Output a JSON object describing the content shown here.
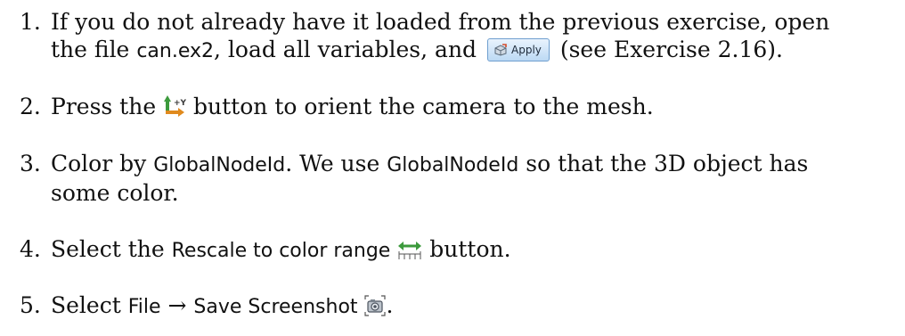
{
  "steps": [
    {
      "number": "1.",
      "text_a": "If you do not already have it loaded from the previous exercise, open",
      "text_b": "the file ",
      "file": "can.ex2",
      "text_c": ", load all variables, and",
      "apply_label": "Apply",
      "text_d": "(see Exercise 2.16)."
    },
    {
      "number": "2.",
      "text_a": "Press the",
      "text_b": "button to orient the camera to the mesh.",
      "icon": "orient-camera-plus-y-icon"
    },
    {
      "number": "3.",
      "text_a": "Color by ",
      "var1": "GlobalNodeId",
      "text_b": ". We use ",
      "var2": "GlobalNodeId",
      "text_c": " so that the 3D object has",
      "text_d": "some color."
    },
    {
      "number": "4.",
      "text_a": "Select the ",
      "action": "Rescale to color range",
      "text_b": "button.",
      "icon": "rescale-color-range-icon"
    },
    {
      "number": "5.",
      "text_a": "Select ",
      "menu": "File",
      "arrow": "→",
      "menu_item": "Save Screenshot",
      "text_b": ".",
      "icon": "camera-screenshot-icon"
    }
  ],
  "colors": {
    "text": "#111111",
    "apply_border": "#6f9fcf",
    "icon_green": "#3c9a3c",
    "icon_orange": "#e08a1e"
  }
}
